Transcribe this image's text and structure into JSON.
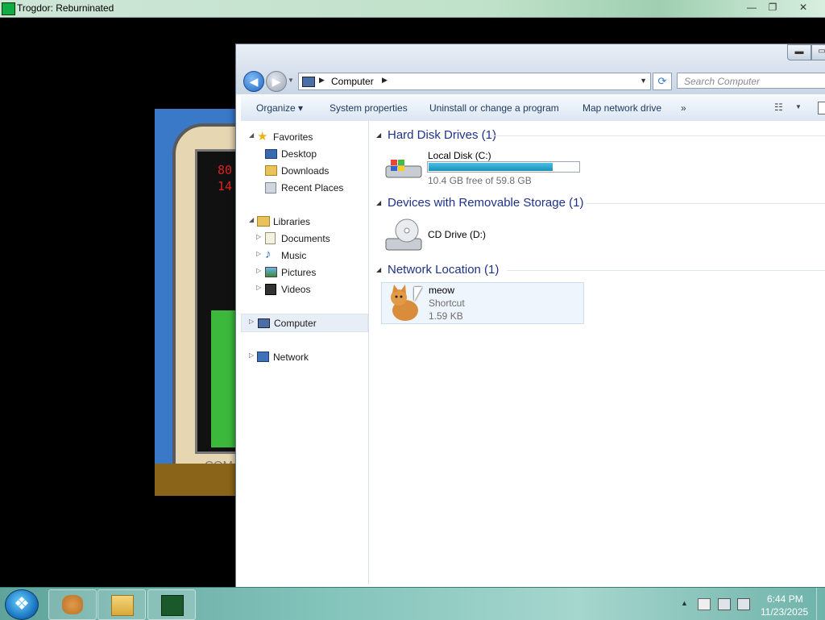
{
  "game_window": {
    "title": "Trogdor: Reburninated",
    "minimize": "—",
    "maximize": "❐",
    "close": "✕",
    "screen_text_1": "80",
    "screen_text_2": "14",
    "screen_brand": "COM"
  },
  "explorer": {
    "minimize": "▬",
    "maximize": "▭",
    "address": {
      "crumb": "Computer",
      "sep": "▶",
      "dropdown": "▼"
    },
    "search": {
      "placeholder": "Search Computer"
    },
    "commands": {
      "organize": "Organize ▾",
      "system_properties": "System properties",
      "uninstall": "Uninstall or change a program",
      "map_drive": "Map network drive",
      "more": "»"
    },
    "nav": {
      "favorites": "Favorites",
      "desktop": "Desktop",
      "downloads": "Downloads",
      "recent_places": "Recent Places",
      "libraries": "Libraries",
      "documents": "Documents",
      "music": "Music",
      "pictures": "Pictures",
      "videos": "Videos",
      "computer": "Computer",
      "network": "Network"
    },
    "groups": {
      "hdd": "Hard Disk Drives (1)",
      "removable": "Devices with Removable Storage (1)",
      "network": "Network Location (1)"
    },
    "items": {
      "local_disk": {
        "name": "Local Disk (C:)",
        "free": "10.4 GB free of 59.8 GB",
        "used_fraction": 0.826
      },
      "cd_drive": {
        "name": "CD Drive (D:)"
      },
      "meow": {
        "name": "meow",
        "type": "Shortcut",
        "size": "1.59 KB"
      }
    }
  },
  "taskbar": {
    "start": "❖",
    "tray_arrow": "▲",
    "time": "6:44 PM",
    "date": "11/23/2025"
  },
  "colors": {
    "accent": "#1e3287",
    "taskbar": "#83c4bb",
    "disk_bar": "#1c8fb9"
  }
}
